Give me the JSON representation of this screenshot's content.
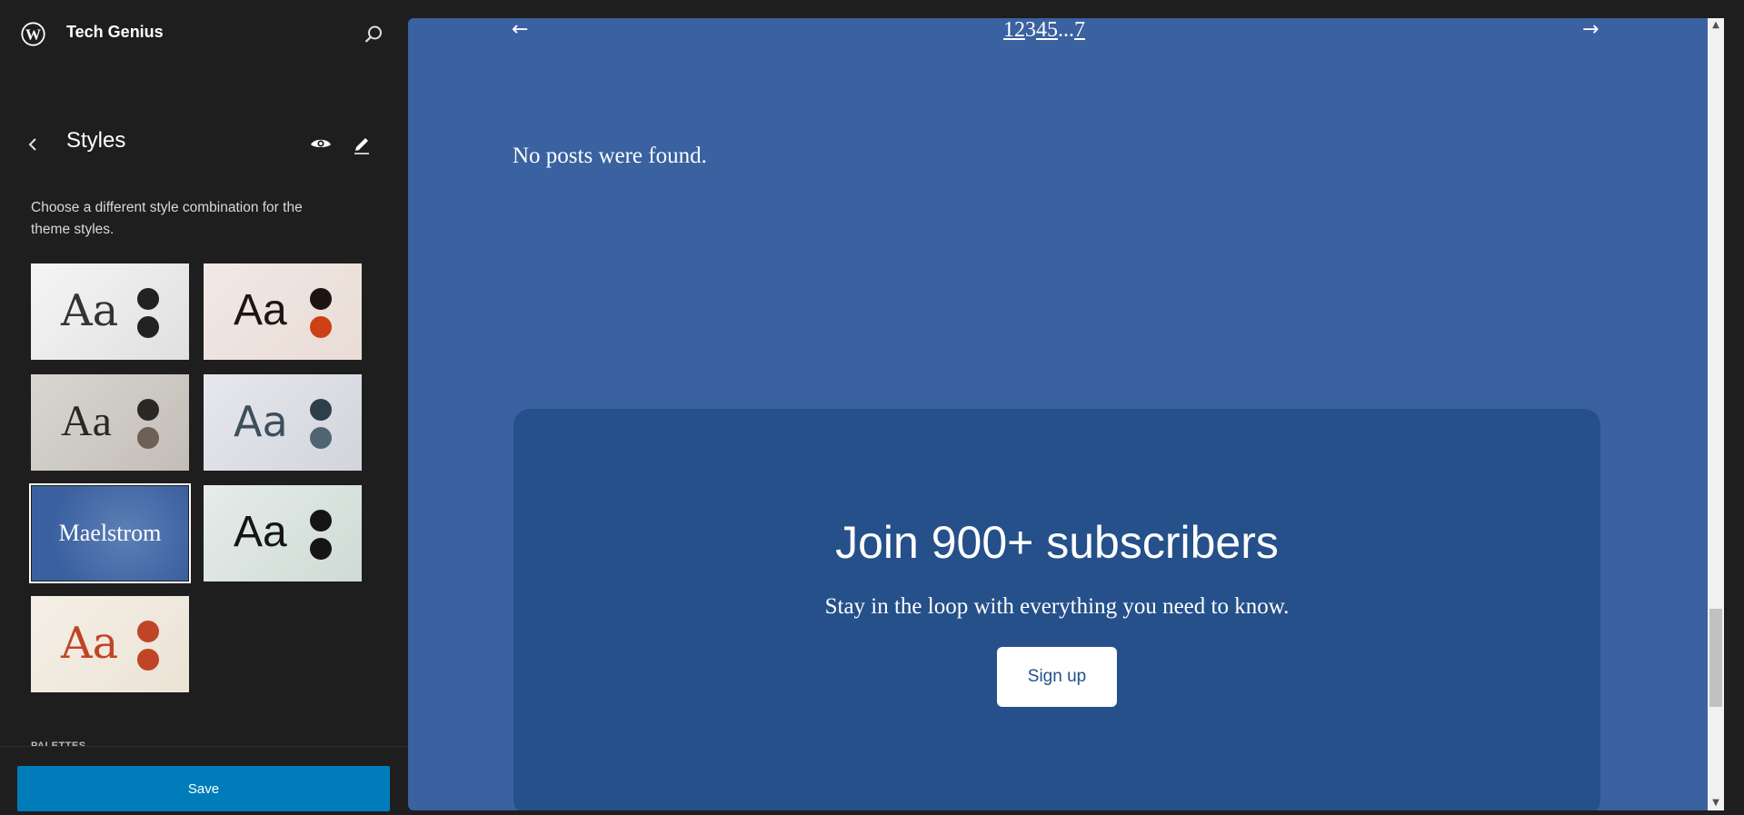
{
  "site": {
    "title": "Tech Genius",
    "logo_icon": "wordpress-logo-icon",
    "search_icon": "search-icon"
  },
  "styles_panel": {
    "title": "Styles",
    "description": "Choose a different style combination for the theme styles.",
    "back_icon": "chevron-left-icon",
    "preview_icon": "eye-icon",
    "edit_icon": "pencil-icon",
    "variations": [
      {
        "sample": "Aa",
        "colors": [
          "#222222",
          "#222222"
        ]
      },
      {
        "sample": "Aa",
        "colors": [
          "#1c1512",
          "#cc4115"
        ]
      },
      {
        "sample": "Aa",
        "colors": [
          "#2b2725",
          "#6e5f57"
        ]
      },
      {
        "sample": "Aa",
        "colors": [
          "#2f3f4a",
          "#4f6573"
        ]
      },
      {
        "sample": "Maelstrom",
        "selected": true
      },
      {
        "sample": "Aa",
        "colors": [
          "#151515",
          "#151515"
        ]
      },
      {
        "sample": "Aa",
        "colors": [
          "#bf4526",
          "#bf4526"
        ]
      }
    ],
    "section_label": "PALETTES"
  },
  "footer": {
    "save_label": "Save",
    "accent": "#007cba"
  },
  "preview": {
    "background": "#3a61a0",
    "pagination": {
      "prev": "←",
      "next": "→",
      "pages": [
        "1",
        "2",
        "3",
        "4",
        "5",
        "...",
        "7"
      ],
      "current": "3"
    },
    "no_posts": "No posts were found.",
    "subscribe": {
      "title": "Join 900+ subscribers",
      "text": "Stay in the loop with everything you need to know.",
      "button": "Sign up"
    }
  }
}
